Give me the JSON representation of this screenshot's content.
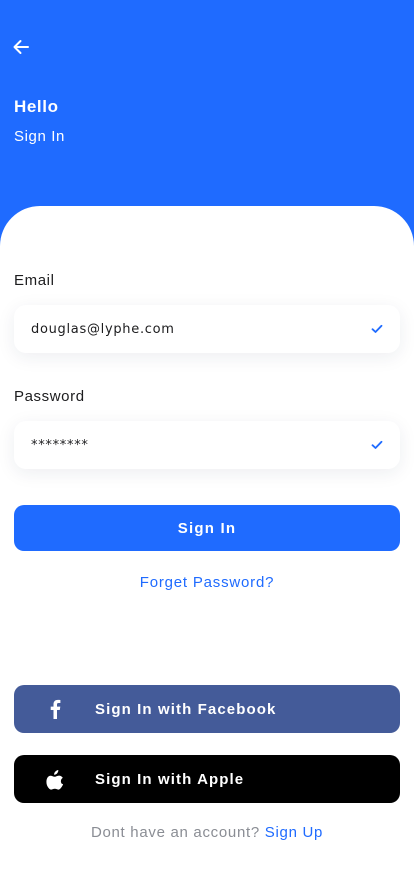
{
  "header": {
    "title": "Hello",
    "subtitle": "Sign In",
    "background_color": "#1f6bff",
    "back_icon": "arrow-left-icon"
  },
  "form": {
    "email": {
      "label": "Email",
      "value": "douglas@lyphe.com",
      "status_icon": "check-icon"
    },
    "password": {
      "label": "Password",
      "value": "********",
      "status_icon": "check-icon"
    },
    "submit_label": "Sign In",
    "forgot_label": "Forget Password?"
  },
  "social": {
    "facebook": {
      "label": "Sign In with Facebook",
      "icon": "facebook-icon",
      "color": "#445b99"
    },
    "apple": {
      "label": "Sign In with Apple",
      "icon": "apple-icon",
      "color": "#000000"
    }
  },
  "footer": {
    "prompt": "Dont have an account?",
    "link": "Sign Up"
  },
  "accent_color": "#1f6bff"
}
